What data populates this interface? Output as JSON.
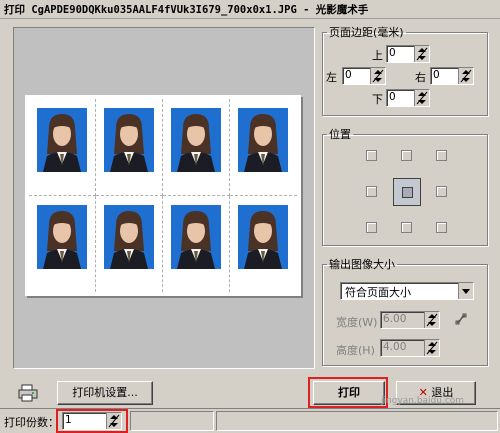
{
  "window": {
    "title": "打印 CgAPDE90DQKku035AALF4fVUk3I679_700x0x1.JPG - 光影魔术手",
    "close_label": "✕"
  },
  "margins": {
    "legend": "页面边距(毫米)",
    "top_label": "上",
    "top_value": "0",
    "left_label": "左",
    "left_value": "0",
    "right_label": "右",
    "right_value": "0",
    "bottom_label": "下",
    "bottom_value": "0"
  },
  "position": {
    "legend": "位置",
    "selected": "center"
  },
  "output_size": {
    "legend": "输出图像大小",
    "mode_value": "符合页面大小",
    "width_label": "宽度(W)",
    "width_value": "6.00",
    "height_label": "高度(H)",
    "height_value": "4.00"
  },
  "preview": {
    "photo_count": 8
  },
  "footer": {
    "printer_settings_label": "打印机设置...",
    "print_label": "打印",
    "exit_label": "退出",
    "copies_label": "打印份数：",
    "copies_value": "1"
  },
  "watermark": {
    "text": "jingyan.baidu.com"
  },
  "colors": {
    "highlight": "#e02020",
    "photo_bg": "#1f6fd0",
    "dialog_bg": "#d4d0c8"
  }
}
